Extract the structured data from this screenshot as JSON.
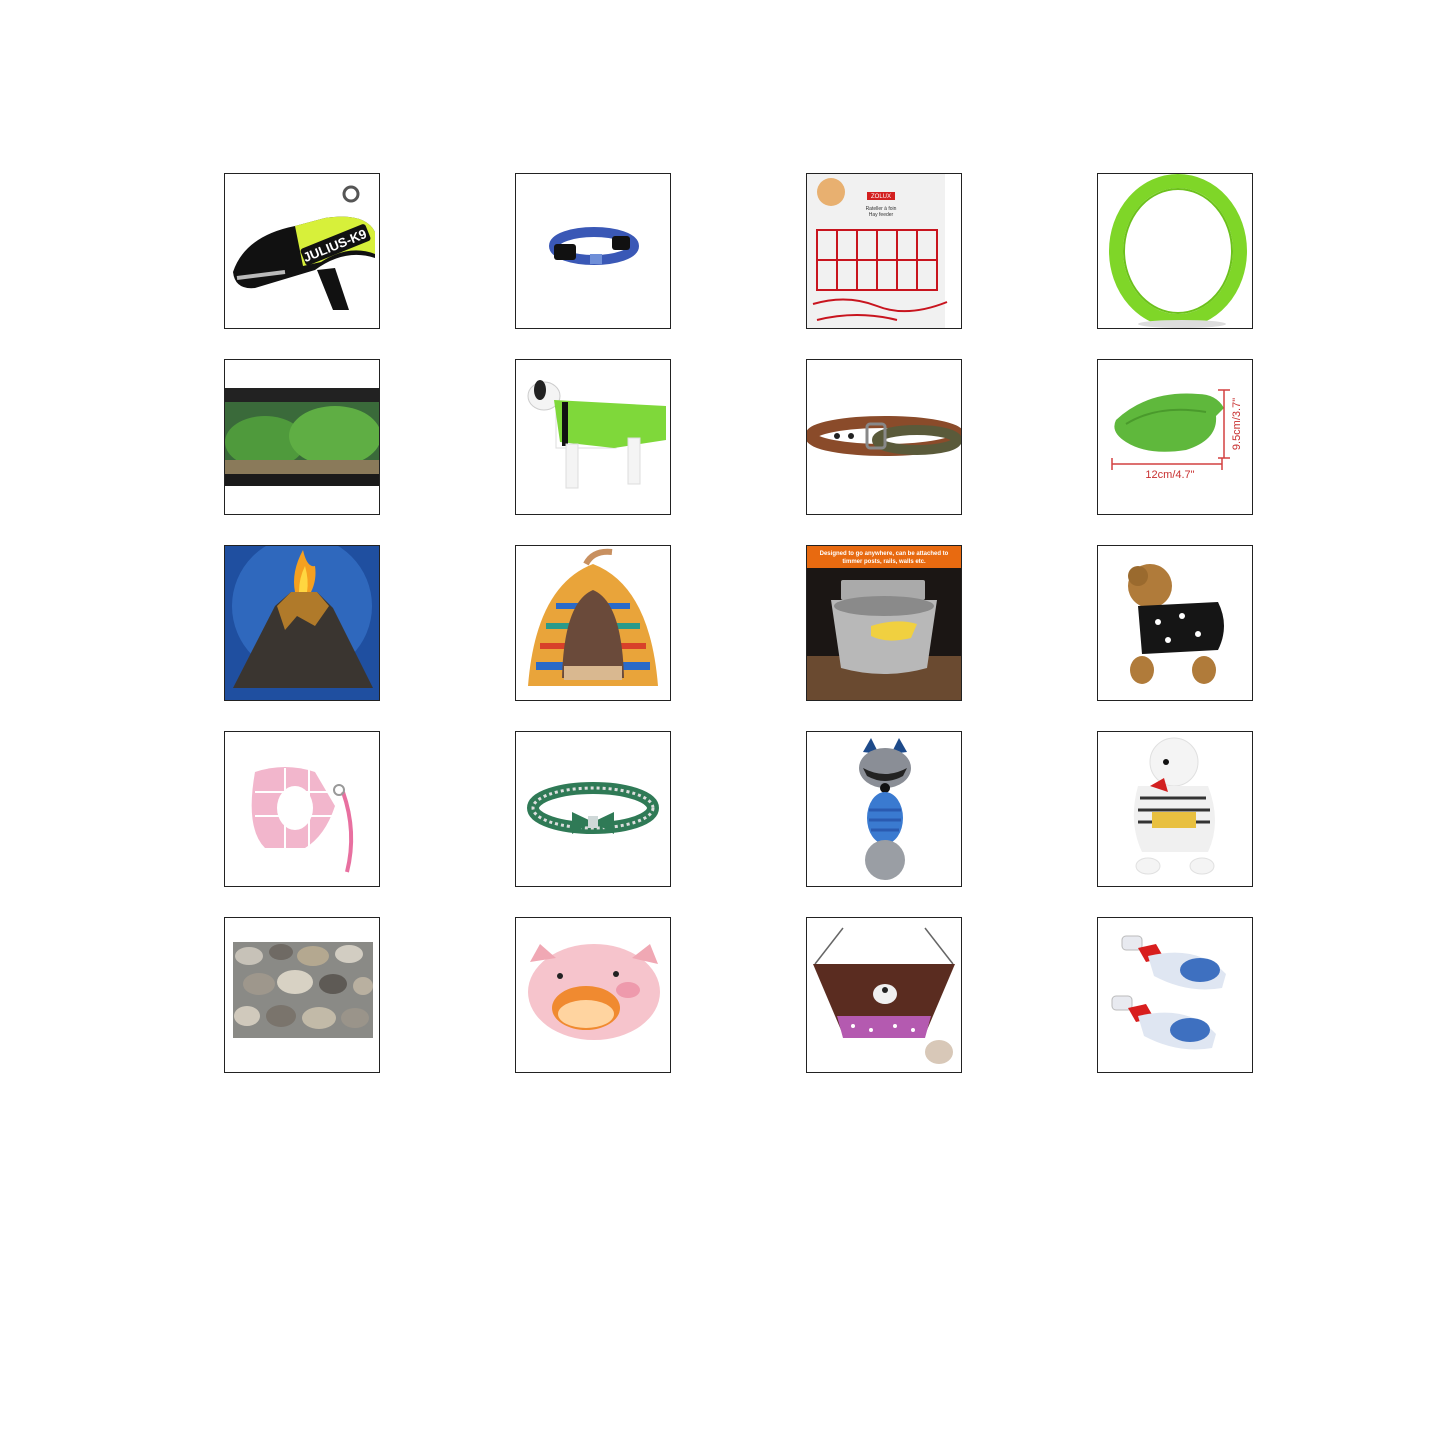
{
  "products": [
    {
      "icon": "dog-harness-icon",
      "text": [
        "JULIUS-K9"
      ]
    },
    {
      "icon": "dog-collar-icon",
      "text": []
    },
    {
      "icon": "hay-feeder-icon",
      "text": [
        "ZOLUX",
        "Rateller à foin",
        "Hay feeder"
      ]
    },
    {
      "icon": "ring-toy-icon",
      "text": []
    },
    {
      "icon": "aquarium-tank-icon",
      "text": []
    },
    {
      "icon": "dog-coat-icon",
      "text": []
    },
    {
      "icon": "leather-collar-icon",
      "text": []
    },
    {
      "icon": "leaf-dish-icon",
      "text": [
        "12cm/4.7\"",
        "9.5cm/3.7\""
      ]
    },
    {
      "icon": "volcano-ornament-icon",
      "text": []
    },
    {
      "icon": "pet-tent-bed-icon",
      "text": []
    },
    {
      "icon": "water-bowl-icon",
      "text": [
        "Designed to go anywhere, can be attached to",
        "timmer posts, rails, walls etc."
      ]
    },
    {
      "icon": "dog-sweater-icon",
      "text": []
    },
    {
      "icon": "pink-harness-leash-icon",
      "text": []
    },
    {
      "icon": "bow-collar-icon",
      "text": []
    },
    {
      "icon": "raccoon-toy-icon",
      "text": []
    },
    {
      "icon": "dog-shirt-icon",
      "text": []
    },
    {
      "icon": "pebbles-icon",
      "text": []
    },
    {
      "icon": "pig-bed-icon",
      "text": []
    },
    {
      "icon": "hammock-icon",
      "text": []
    },
    {
      "icon": "pet-shoes-icon",
      "text": []
    }
  ]
}
